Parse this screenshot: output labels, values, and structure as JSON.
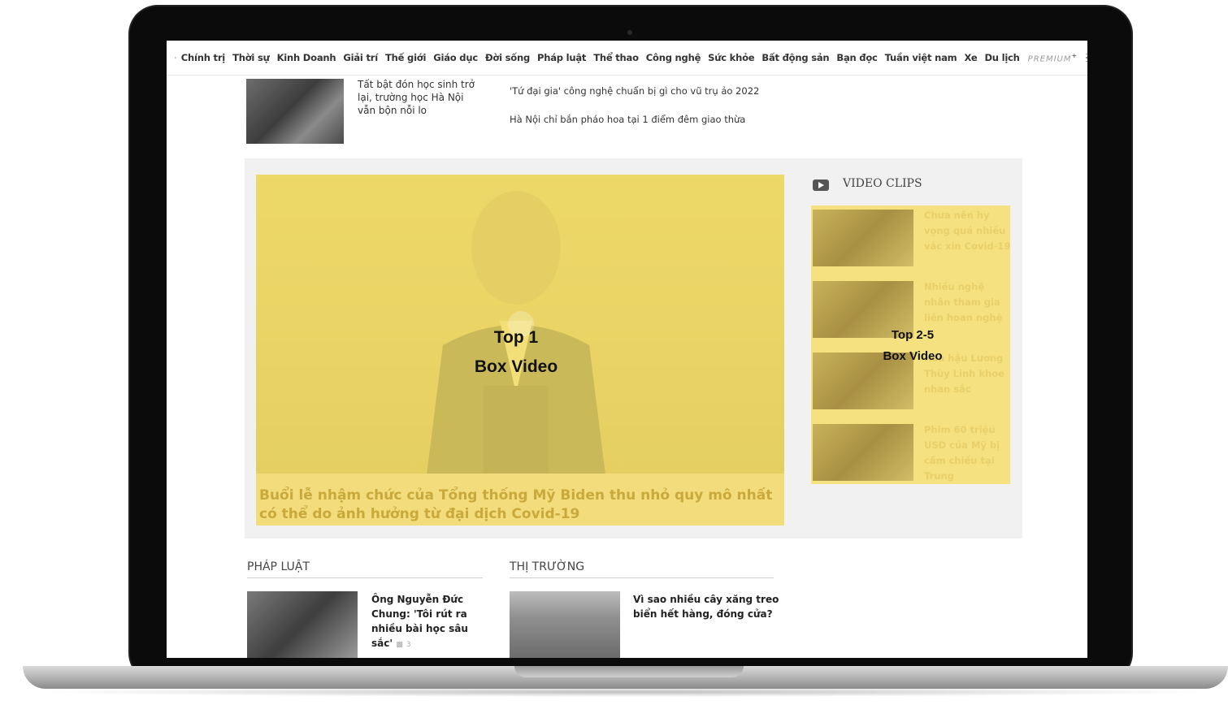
{
  "nav": {
    "items": [
      "Chính trị",
      "Thời sự",
      "Kinh Doanh",
      "Giải trí",
      "Thế giới",
      "Giáo dục",
      "Đời sống",
      "Pháp luật",
      "Thể thao",
      "Công nghệ",
      "Sức khỏe",
      "Bất động sản",
      "Bạn đọc",
      "Tuần việt nam",
      "Xe",
      "Du lịch"
    ],
    "premium": "PREMIUM",
    "premium_mark": "+"
  },
  "top_article": {
    "title": "Tất bật đón học sinh trở lại, trường học Hà Nội vẫn bộn nỗi lo"
  },
  "side_links": [
    "'Tứ đại gia' công nghệ chuẩn bị gì cho vũ trụ ảo 2022",
    "Hà Nội chỉ bắn pháo hoa tại 1 điểm đêm giao thừa"
  ],
  "video_box": {
    "main_caption": "Buổi lễ nhậm chức của Tổng thống Mỹ Biden thu nhỏ quy mô nhất có thể do ảnh hưởng từ đại dịch Covid-19",
    "label_line1": "Top 1",
    "label_line2": "Box Video",
    "clips_heading": "VIDEO CLIPS",
    "clips": [
      "Chưa nên hy vọng quá nhiều vắc xin Covid-19",
      "Nhiều nghệ nhân tham gia liên hoan nghệ",
      "Hoa hậu Lương Thùy Linh khoe nhan sắc",
      "Phim 60 triệu USD của Mỹ bị cấm chiếu tại Trung"
    ],
    "side_label_line1": "Top 2-5",
    "side_label_line2": "Box Video"
  },
  "sections": {
    "phap_luat": {
      "title": "PHÁP LUẬT",
      "article": "Ông Nguyễn Đức Chung: 'Tôi rút ra nhiều bài học sâu sắc'",
      "comments": "3"
    },
    "thi_truong": {
      "title": "THỊ TRƯỜNG",
      "article": "Vì sao nhiều cây xăng treo biển hết hàng, đóng cửa?"
    }
  }
}
